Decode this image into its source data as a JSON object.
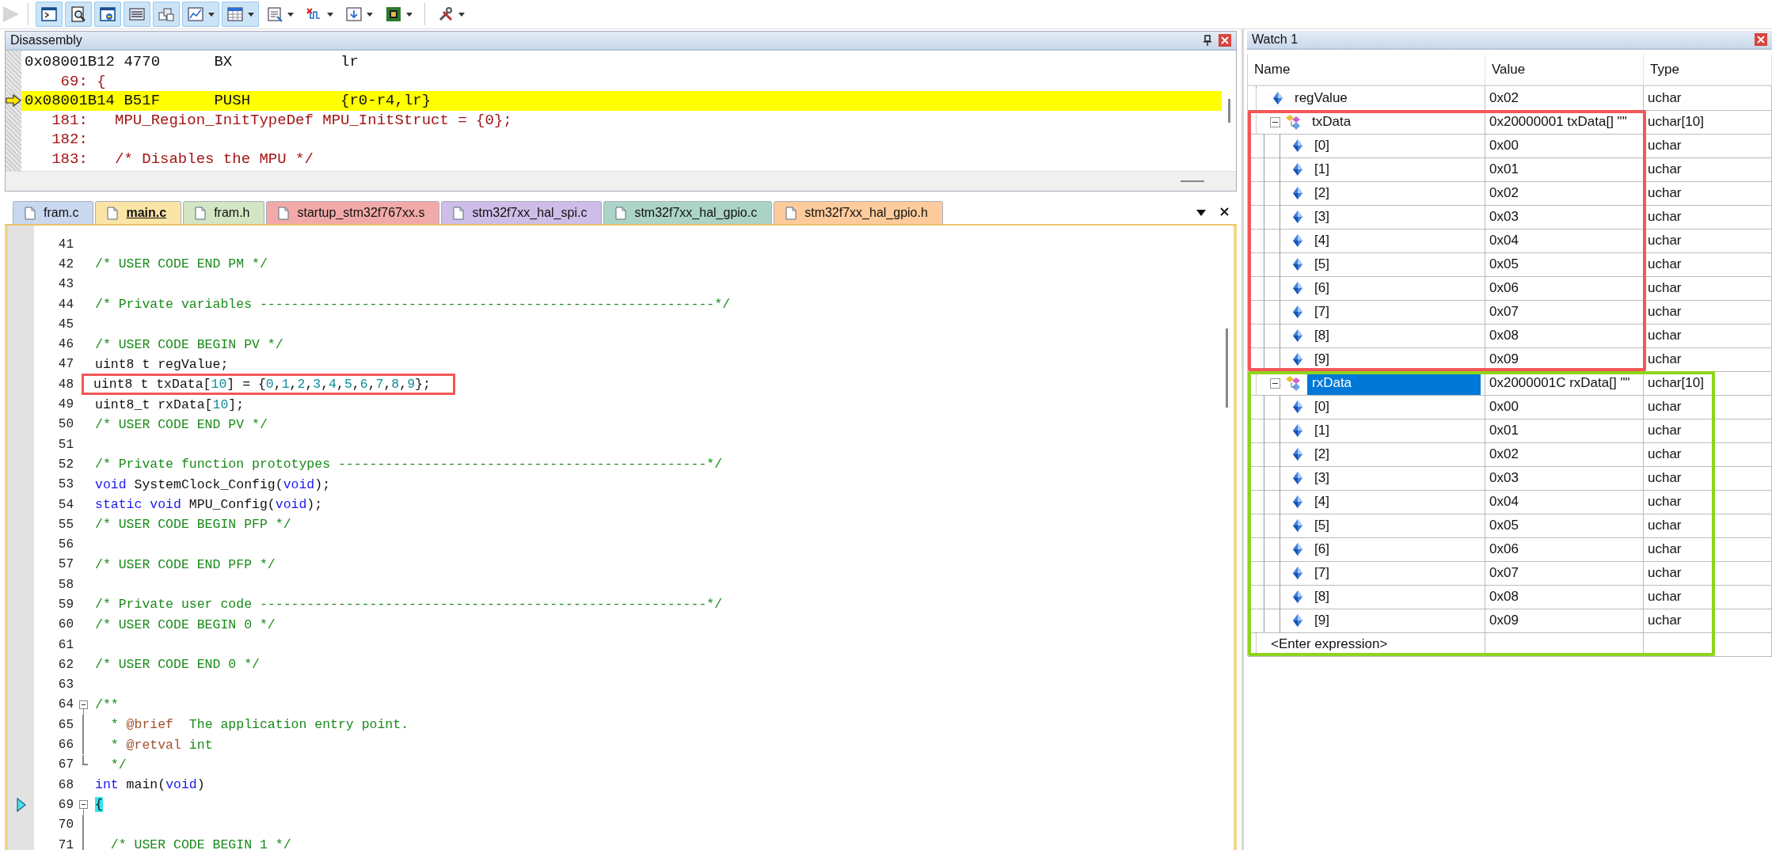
{
  "toolbar": {
    "buttons": [
      {
        "kind": "step",
        "pressed": false,
        "disabled": true,
        "dropdown": false
      },
      {
        "kind": "terminal",
        "pressed": true,
        "disabled": false,
        "dropdown": false
      },
      {
        "kind": "magnifier",
        "pressed": true,
        "disabled": false,
        "dropdown": false
      },
      {
        "kind": "window",
        "pressed": true,
        "disabled": false,
        "dropdown": false
      },
      {
        "kind": "list",
        "pressed": true,
        "disabled": false,
        "dropdown": false
      },
      {
        "kind": "stack",
        "pressed": true,
        "disabled": false,
        "dropdown": false
      },
      {
        "kind": "chart",
        "pressed": true,
        "disabled": false,
        "dropdown": true
      },
      {
        "kind": "grid",
        "pressed": true,
        "disabled": false,
        "dropdown": true
      },
      {
        "kind": "document",
        "pressed": false,
        "disabled": false,
        "dropdown": true
      },
      {
        "kind": "wave",
        "pressed": false,
        "disabled": false,
        "dropdown": true
      },
      {
        "kind": "download",
        "pressed": false,
        "disabled": false,
        "dropdown": true
      },
      {
        "kind": "chip",
        "pressed": false,
        "disabled": false,
        "dropdown": true
      },
      {
        "kind": "tools",
        "pressed": false,
        "disabled": false,
        "dropdown": true
      }
    ]
  },
  "disassembly": {
    "title": "Disassembly",
    "lines": [
      {
        "kind": "asm",
        "text": "0x08001B12 4770      BX            lr",
        "current": false
      },
      {
        "kind": "source",
        "text": "    69: {",
        "current": false
      },
      {
        "kind": "asm",
        "text": "0x08001B14 B51F      PUSH          {r0-r4,lr}",
        "current": true
      },
      {
        "kind": "source",
        "text": "   181:   MPU_Region_InitTypeDef MPU_InitStruct = {0};",
        "current": false
      },
      {
        "kind": "source",
        "text": "   182: ",
        "current": false
      },
      {
        "kind": "source",
        "text": "   183:   /* Disables the MPU */",
        "current": false
      }
    ]
  },
  "editor": {
    "tabs": [
      {
        "label": "fram.c",
        "color": "#c9d7ef",
        "selected": false
      },
      {
        "label": "main.c",
        "color": "#fbe5a6",
        "selected": true
      },
      {
        "label": "fram.h",
        "color": "#d3e5c3",
        "selected": false
      },
      {
        "label": "startup_stm32f767xx.s",
        "color": "#f2aaa8",
        "selected": false
      },
      {
        "label": "stm32f7xx_hal_spi.c",
        "color": "#cdbde8",
        "selected": false
      },
      {
        "label": "stm32f7xx_hal_gpio.c",
        "color": "#abd4c6",
        "selected": false
      },
      {
        "label": "stm32f7xx_hal_gpio.h",
        "color": "#fdcb9c",
        "selected": false
      }
    ],
    "lines": [
      {
        "number": "41"
      },
      {
        "number": "42",
        "segments": [
          {
            "kind": "comment",
            "text": "/* USER CODE END PM */"
          }
        ]
      },
      {
        "number": "43"
      },
      {
        "number": "44",
        "segments": [
          {
            "kind": "comment",
            "text": "/* Private variables ----------------------------------------------------------*/"
          }
        ]
      },
      {
        "number": "45"
      },
      {
        "number": "46",
        "segments": [
          {
            "kind": "comment",
            "text": "/* USER CODE BEGIN PV */"
          }
        ]
      },
      {
        "number": "47",
        "segments": [
          {
            "kind": "plain",
            "text": "uint8 t regValue;"
          }
        ]
      },
      {
        "number": "48",
        "color": "#f25757",
        "segments": [
          {
            "kind": "plain",
            "text": "uint8 t txData["
          },
          {
            "kind": "number",
            "text": "10"
          },
          {
            "kind": "plain",
            "text": "] = {"
          },
          {
            "kind": "number",
            "text": "0"
          },
          {
            "kind": "plain",
            "text": ","
          },
          {
            "kind": "number",
            "text": "1"
          },
          {
            "kind": "plain",
            "text": ","
          },
          {
            "kind": "number",
            "text": "2"
          },
          {
            "kind": "plain",
            "text": ","
          },
          {
            "kind": "number",
            "text": "3"
          },
          {
            "kind": "plain",
            "text": ","
          },
          {
            "kind": "number",
            "text": "4"
          },
          {
            "kind": "plain",
            "text": ","
          },
          {
            "kind": "number",
            "text": "5"
          },
          {
            "kind": "plain",
            "text": ","
          },
          {
            "kind": "number",
            "text": "6"
          },
          {
            "kind": "plain",
            "text": ","
          },
          {
            "kind": "number",
            "text": "7"
          },
          {
            "kind": "plain",
            "text": ","
          },
          {
            "kind": "number",
            "text": "8"
          },
          {
            "kind": "plain",
            "text": ","
          },
          {
            "kind": "number",
            "text": "9"
          },
          {
            "kind": "plain",
            "text": "};"
          }
        ]
      },
      {
        "number": "49",
        "segments": [
          {
            "kind": "plain",
            "text": "uint8_t rxData["
          },
          {
            "kind": "number",
            "text": "10"
          },
          {
            "kind": "plain",
            "text": "];"
          }
        ]
      },
      {
        "number": "50",
        "segments": [
          {
            "kind": "comment",
            "text": "/* USER CODE END PV */"
          }
        ]
      },
      {
        "number": "51"
      },
      {
        "number": "52",
        "segments": [
          {
            "kind": "comment",
            "text": "/* Private function prototypes -----------------------------------------------*/"
          }
        ]
      },
      {
        "number": "53",
        "segments": [
          {
            "kind": "keyword",
            "text": "void"
          },
          {
            "kind": "plain",
            "text": " SystemClock_Config("
          },
          {
            "kind": "keyword",
            "text": "void"
          },
          {
            "kind": "plain",
            "text": ");"
          }
        ]
      },
      {
        "number": "54",
        "segments": [
          {
            "kind": "keyword",
            "text": "static void"
          },
          {
            "kind": "plain",
            "text": " MPU_Config("
          },
          {
            "kind": "keyword",
            "text": "void"
          },
          {
            "kind": "plain",
            "text": ");"
          }
        ]
      },
      {
        "number": "55",
        "segments": [
          {
            "kind": "comment",
            "text": "/* USER CODE BEGIN PFP */"
          }
        ]
      },
      {
        "number": "56"
      },
      {
        "number": "57",
        "segments": [
          {
            "kind": "comment",
            "text": "/* USER CODE END PFP */"
          }
        ]
      },
      {
        "number": "58"
      },
      {
        "number": "59",
        "segments": [
          {
            "kind": "comment",
            "text": "/* Private user code ---------------------------------------------------------*/"
          }
        ]
      },
      {
        "number": "60",
        "segments": [
          {
            "kind": "comment",
            "text": "/* USER CODE BEGIN 0 */"
          }
        ]
      },
      {
        "number": "61"
      },
      {
        "number": "62",
        "segments": [
          {
            "kind": "comment",
            "text": "/* USER CODE END 0 */"
          }
        ]
      },
      {
        "number": "63"
      },
      {
        "number": "64",
        "kind": "fold-start",
        "segments": [
          {
            "kind": "comment",
            "text": "/**"
          }
        ]
      },
      {
        "number": "65",
        "kind": "fold-body",
        "segments": [
          {
            "kind": "comment",
            "text": "  * "
          },
          {
            "kind": "doc",
            "text": "@brief"
          },
          {
            "kind": "comment",
            "text": "  The application entry point."
          }
        ]
      },
      {
        "number": "66",
        "kind": "fold-body",
        "segments": [
          {
            "kind": "comment",
            "text": "  * "
          },
          {
            "kind": "doc",
            "text": "@retval"
          },
          {
            "kind": "comment",
            "text": " int"
          }
        ]
      },
      {
        "number": "67",
        "kind": "fold-end",
        "segments": [
          {
            "kind": "comment",
            "text": "  */"
          }
        ]
      },
      {
        "number": "68",
        "segments": [
          {
            "kind": "keyword",
            "text": "int"
          },
          {
            "kind": "plain",
            "text": " main("
          },
          {
            "kind": "keyword",
            "text": "void"
          },
          {
            "kind": "plain",
            "text": ")"
          }
        ]
      },
      {
        "number": "69",
        "kind": "fold-start",
        "current": true,
        "segments": [
          {
            "kind": "brace",
            "text": "{"
          }
        ]
      },
      {
        "number": "70",
        "kind": "fold-body"
      },
      {
        "number": "71",
        "kind": "fold-body",
        "segments": [
          {
            "kind": "comment",
            "text": "  /* USER CODE BEGIN 1 */"
          }
        ]
      }
    ]
  },
  "watch": {
    "title": "Watch 1",
    "columns": [
      "Name",
      "Value",
      "Type"
    ],
    "items": [
      {
        "name": "regValue",
        "value": "0x02",
        "type": "uchar",
        "kind": "scalar",
        "selected": false
      },
      {
        "name": "txData",
        "value": "0x20000001 txData[] \"\"",
        "type": "uchar[10]",
        "kind": "array",
        "expanded": true,
        "selected": false,
        "color": "#f25757",
        "children": [
          {
            "name": "[0]",
            "value": "0x00",
            "type": "uchar",
            "kind": "scalar",
            "selected": false
          },
          {
            "name": "[1]",
            "value": "0x01",
            "type": "uchar",
            "kind": "scalar",
            "selected": false
          },
          {
            "name": "[2]",
            "value": "0x02",
            "type": "uchar",
            "kind": "scalar",
            "selected": false
          },
          {
            "name": "[3]",
            "value": "0x03",
            "type": "uchar",
            "kind": "scalar",
            "selected": false
          },
          {
            "name": "[4]",
            "value": "0x04",
            "type": "uchar",
            "kind": "scalar",
            "selected": false
          },
          {
            "name": "[5]",
            "value": "0x05",
            "type": "uchar",
            "kind": "scalar",
            "selected": false
          },
          {
            "name": "[6]",
            "value": "0x06",
            "type": "uchar",
            "kind": "scalar",
            "selected": false
          },
          {
            "name": "[7]",
            "value": "0x07",
            "type": "uchar",
            "kind": "scalar",
            "selected": false
          },
          {
            "name": "[8]",
            "value": "0x08",
            "type": "uchar",
            "kind": "scalar",
            "selected": false
          },
          {
            "name": "[9]",
            "value": "0x09",
            "type": "uchar",
            "kind": "scalar",
            "selected": false
          }
        ]
      },
      {
        "name": "rxData",
        "value": "0x2000001C rxData[] \"\"",
        "type": "uchar[10]",
        "kind": "array",
        "expanded": true,
        "selected": true,
        "color": "#8ed41c",
        "children": [
          {
            "name": "[0]",
            "value": "0x00",
            "type": "uchar",
            "kind": "scalar",
            "selected": false
          },
          {
            "name": "[1]",
            "value": "0x01",
            "type": "uchar",
            "kind": "scalar",
            "selected": false
          },
          {
            "name": "[2]",
            "value": "0x02",
            "type": "uchar",
            "kind": "scalar",
            "selected": false
          },
          {
            "name": "[3]",
            "value": "0x03",
            "type": "uchar",
            "kind": "scalar",
            "selected": false
          },
          {
            "name": "[4]",
            "value": "0x04",
            "type": "uchar",
            "kind": "scalar",
            "selected": false
          },
          {
            "name": "[5]",
            "value": "0x05",
            "type": "uchar",
            "kind": "scalar",
            "selected": false
          },
          {
            "name": "[6]",
            "value": "0x06",
            "type": "uchar",
            "kind": "scalar",
            "selected": false
          },
          {
            "name": "[7]",
            "value": "0x07",
            "type": "uchar",
            "kind": "scalar",
            "selected": false
          },
          {
            "name": "[8]",
            "value": "0x08",
            "type": "uchar",
            "kind": "scalar",
            "selected": false
          },
          {
            "name": "[9]",
            "value": "0x09",
            "type": "uchar",
            "kind": "scalar",
            "selected": false
          }
        ]
      }
    ],
    "entry_row": "<Enter expression>"
  }
}
